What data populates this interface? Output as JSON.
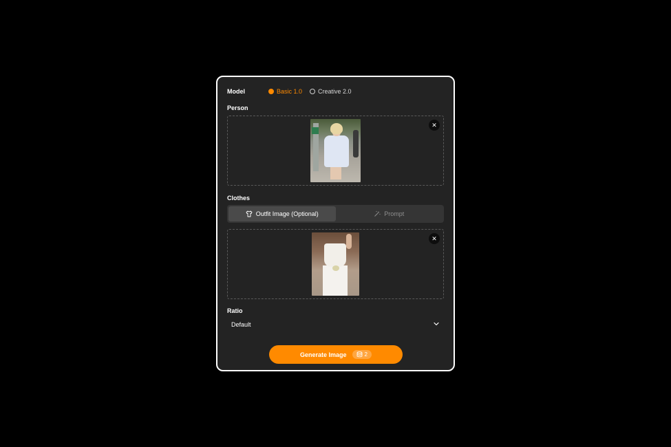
{
  "model": {
    "label": "Model",
    "options": [
      {
        "label": "Basic 1.0",
        "selected": true
      },
      {
        "label": "Creative 2.0",
        "selected": false
      }
    ]
  },
  "person": {
    "label": "Person",
    "close_icon": "close-icon",
    "image_alt": "person-photo"
  },
  "clothes": {
    "label": "Clothes",
    "tabs": [
      {
        "label": "Outfit Image (Optional)",
        "icon": "shirt-icon",
        "active": true
      },
      {
        "label": "Prompt",
        "icon": "magic-wand-icon",
        "active": false
      }
    ],
    "close_icon": "close-icon",
    "image_alt": "outfit-photo"
  },
  "ratio": {
    "label": "Ratio",
    "selected": "Default",
    "icon": "chevron-down-icon"
  },
  "generate": {
    "label": "Generate Image",
    "credits": "2",
    "icon": "coin-stack-icon"
  },
  "colors": {
    "accent": "#ff8a00",
    "panel": "#232323",
    "background": "#000000"
  }
}
